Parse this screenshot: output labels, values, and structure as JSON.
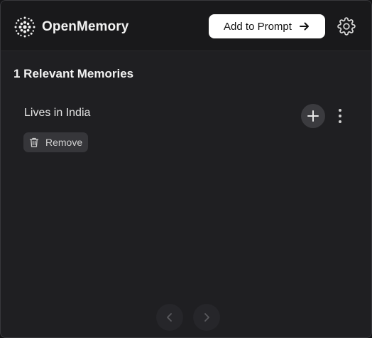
{
  "header": {
    "app_name": "OpenMemory",
    "logo_icon": "openmemory-logo-icon",
    "add_button_label": "Add to Prompt",
    "add_button_icon": "arrow-right-icon",
    "settings_icon": "gear-icon"
  },
  "memories": {
    "title": "1 Relevant Memories",
    "items": [
      {
        "text": "Lives in India",
        "remove_label": "Remove",
        "remove_icon": "trash-icon",
        "add_icon": "plus-icon",
        "more_icon": "more-vertical-icon"
      }
    ]
  },
  "pagination": {
    "prev_icon": "chevron-left-icon",
    "next_icon": "chevron-right-icon"
  },
  "colors": {
    "background": "#1f1f22",
    "header": "#19191b",
    "primary_button": "#ffffff",
    "chip": "#36363a"
  }
}
